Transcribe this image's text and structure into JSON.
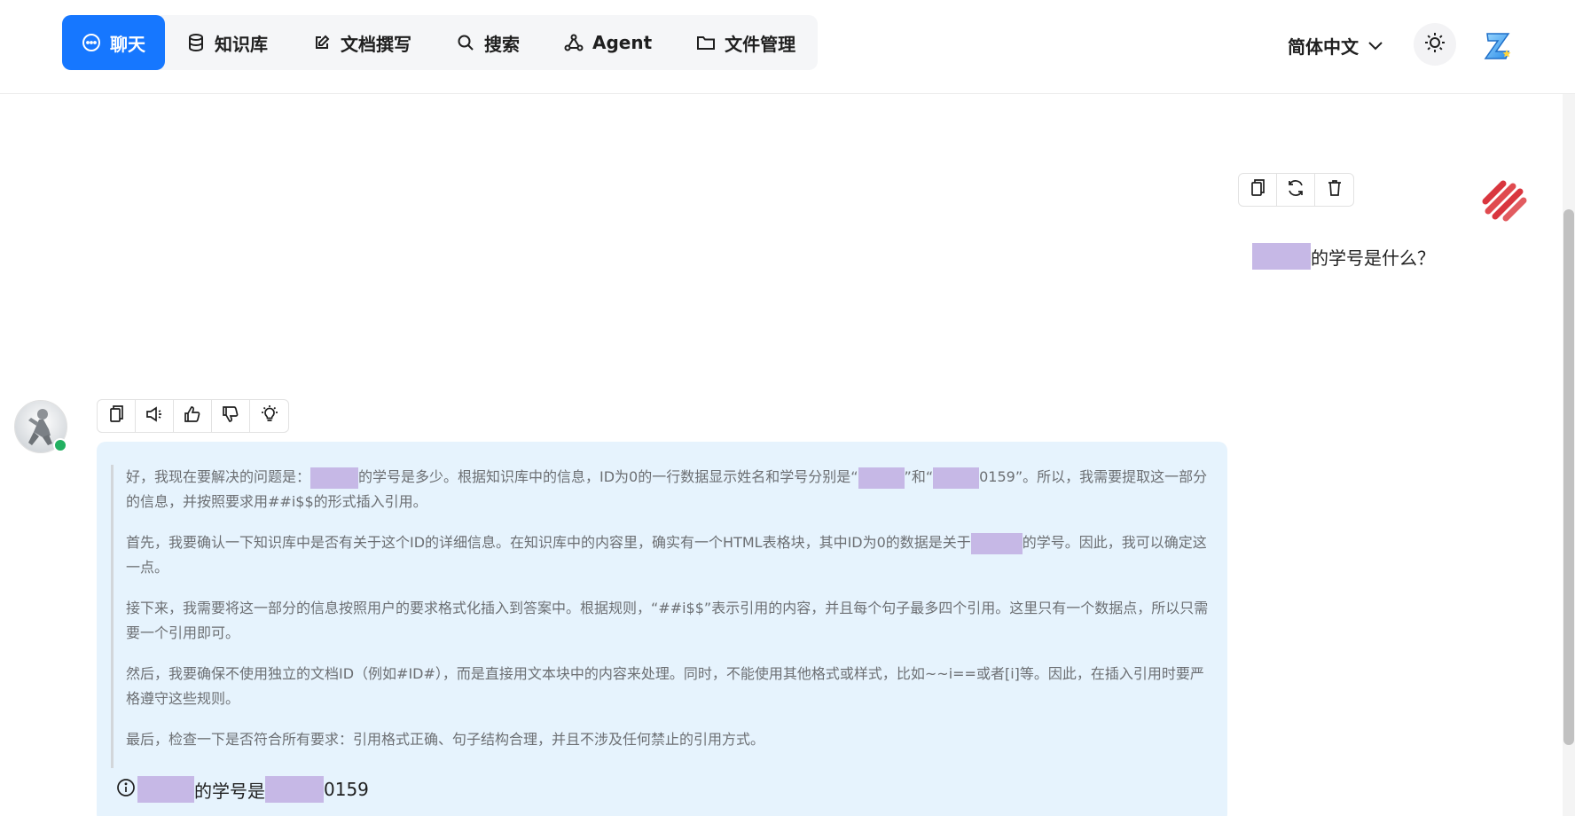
{
  "header": {
    "nav": [
      {
        "label": "聊天",
        "icon": "chat-bubble-icon",
        "active": true
      },
      {
        "label": "知识库",
        "icon": "database-icon",
        "active": false
      },
      {
        "label": "文档撰写",
        "icon": "edit-icon",
        "active": false
      },
      {
        "label": "搜索",
        "icon": "search-icon",
        "active": false
      },
      {
        "label": "Agent",
        "icon": "agent-graph-icon",
        "active": false
      },
      {
        "label": "文件管理",
        "icon": "folder-icon",
        "active": false
      }
    ],
    "language": "简体中文",
    "accent_color": "#1677ff"
  },
  "user_message": {
    "text": "的学号是什么？",
    "toolbar": [
      "copy-icon",
      "regenerate-icon",
      "delete-icon"
    ]
  },
  "assistant_message": {
    "toolbar": [
      "copy-icon",
      "speaker-icon",
      "thumbs-up-icon",
      "thumbs-down-icon",
      "lightbulb-icon"
    ],
    "thinking": [
      {
        "segments": [
          "好，我现在要解决的问题是：",
          "REDACT:54",
          "的学号是多少。根据知识库中的信息，ID为0的一行数据显示姓名和学号分别是“",
          "REDACT:52",
          "”和“",
          "REDACT:52",
          "0159”。所以，我需要提取这一部分的信息，并按照要求用##i$$的形式插入引用。"
        ]
      },
      {
        "segments": [
          "首先，我要确认一下知识库中是否有关于这个ID的详细信息。在知识库中的内容里，确实有一个HTML表格块，其中ID为0的数据是关于",
          "REDACT:58",
          "的学号。因此，我可以确定这一点。"
        ]
      },
      {
        "segments": [
          "接下来，我需要将这一部分的信息按照用户的要求格式化插入到答案中。根据规则，“##i$$”表示引用的内容，并且每个句子最多四个引用。这里只有一个数据点，所以只需要一个引用即可。"
        ]
      },
      {
        "segments": [
          "然后，我要确保不使用独立的文档ID（例如#ID#），而是直接用文本块中的内容来处理。同时，不能使用其他格式或样式，比如~~i==或者[i]等。因此，在插入引用时要严格遵守这些规则。"
        ]
      },
      {
        "segments": [
          "最后，检查一下是否符合所有要求：引用格式正确、句子结构合理，并且不涉及任何禁止的引用方式。"
        ]
      }
    ],
    "answer": {
      "part1": "的学号是",
      "part2": "0159"
    },
    "bubble_color": "#e6f3fd",
    "online_status_color": "#22b061"
  }
}
